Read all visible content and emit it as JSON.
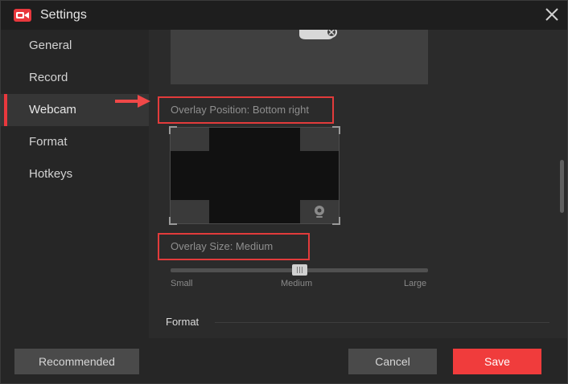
{
  "window": {
    "title": "Settings"
  },
  "icons": {
    "app_logo": "recorder-logo-icon",
    "close": "close-icon",
    "webcam": "webcam-icon",
    "arrow": "pointer-arrow-icon"
  },
  "sidebar": {
    "items": [
      {
        "label": "General",
        "active": false
      },
      {
        "label": "Record",
        "active": false
      },
      {
        "label": "Webcam",
        "active": true
      },
      {
        "label": "Format",
        "active": false
      },
      {
        "label": "Hotkeys",
        "active": false
      }
    ]
  },
  "webcam": {
    "overlay_position_label": "Overlay Position: Bottom right",
    "overlay_position_selected": "bottom-right",
    "overlay_size_label": "Overlay Size: Medium",
    "size_slider": {
      "min_label": "Small",
      "mid_label": "Medium",
      "max_label": "Large",
      "value": 0.5
    }
  },
  "format_section": {
    "heading": "Format"
  },
  "footer": {
    "recommended_label": "Recommended",
    "cancel_label": "Cancel",
    "save_label": "Save"
  },
  "colors": {
    "accent": "#f03c3c",
    "highlight_border": "#e23b3b",
    "active_marker": "#e8383d",
    "background": "#2b2b2b",
    "sidebar": "#262626"
  }
}
